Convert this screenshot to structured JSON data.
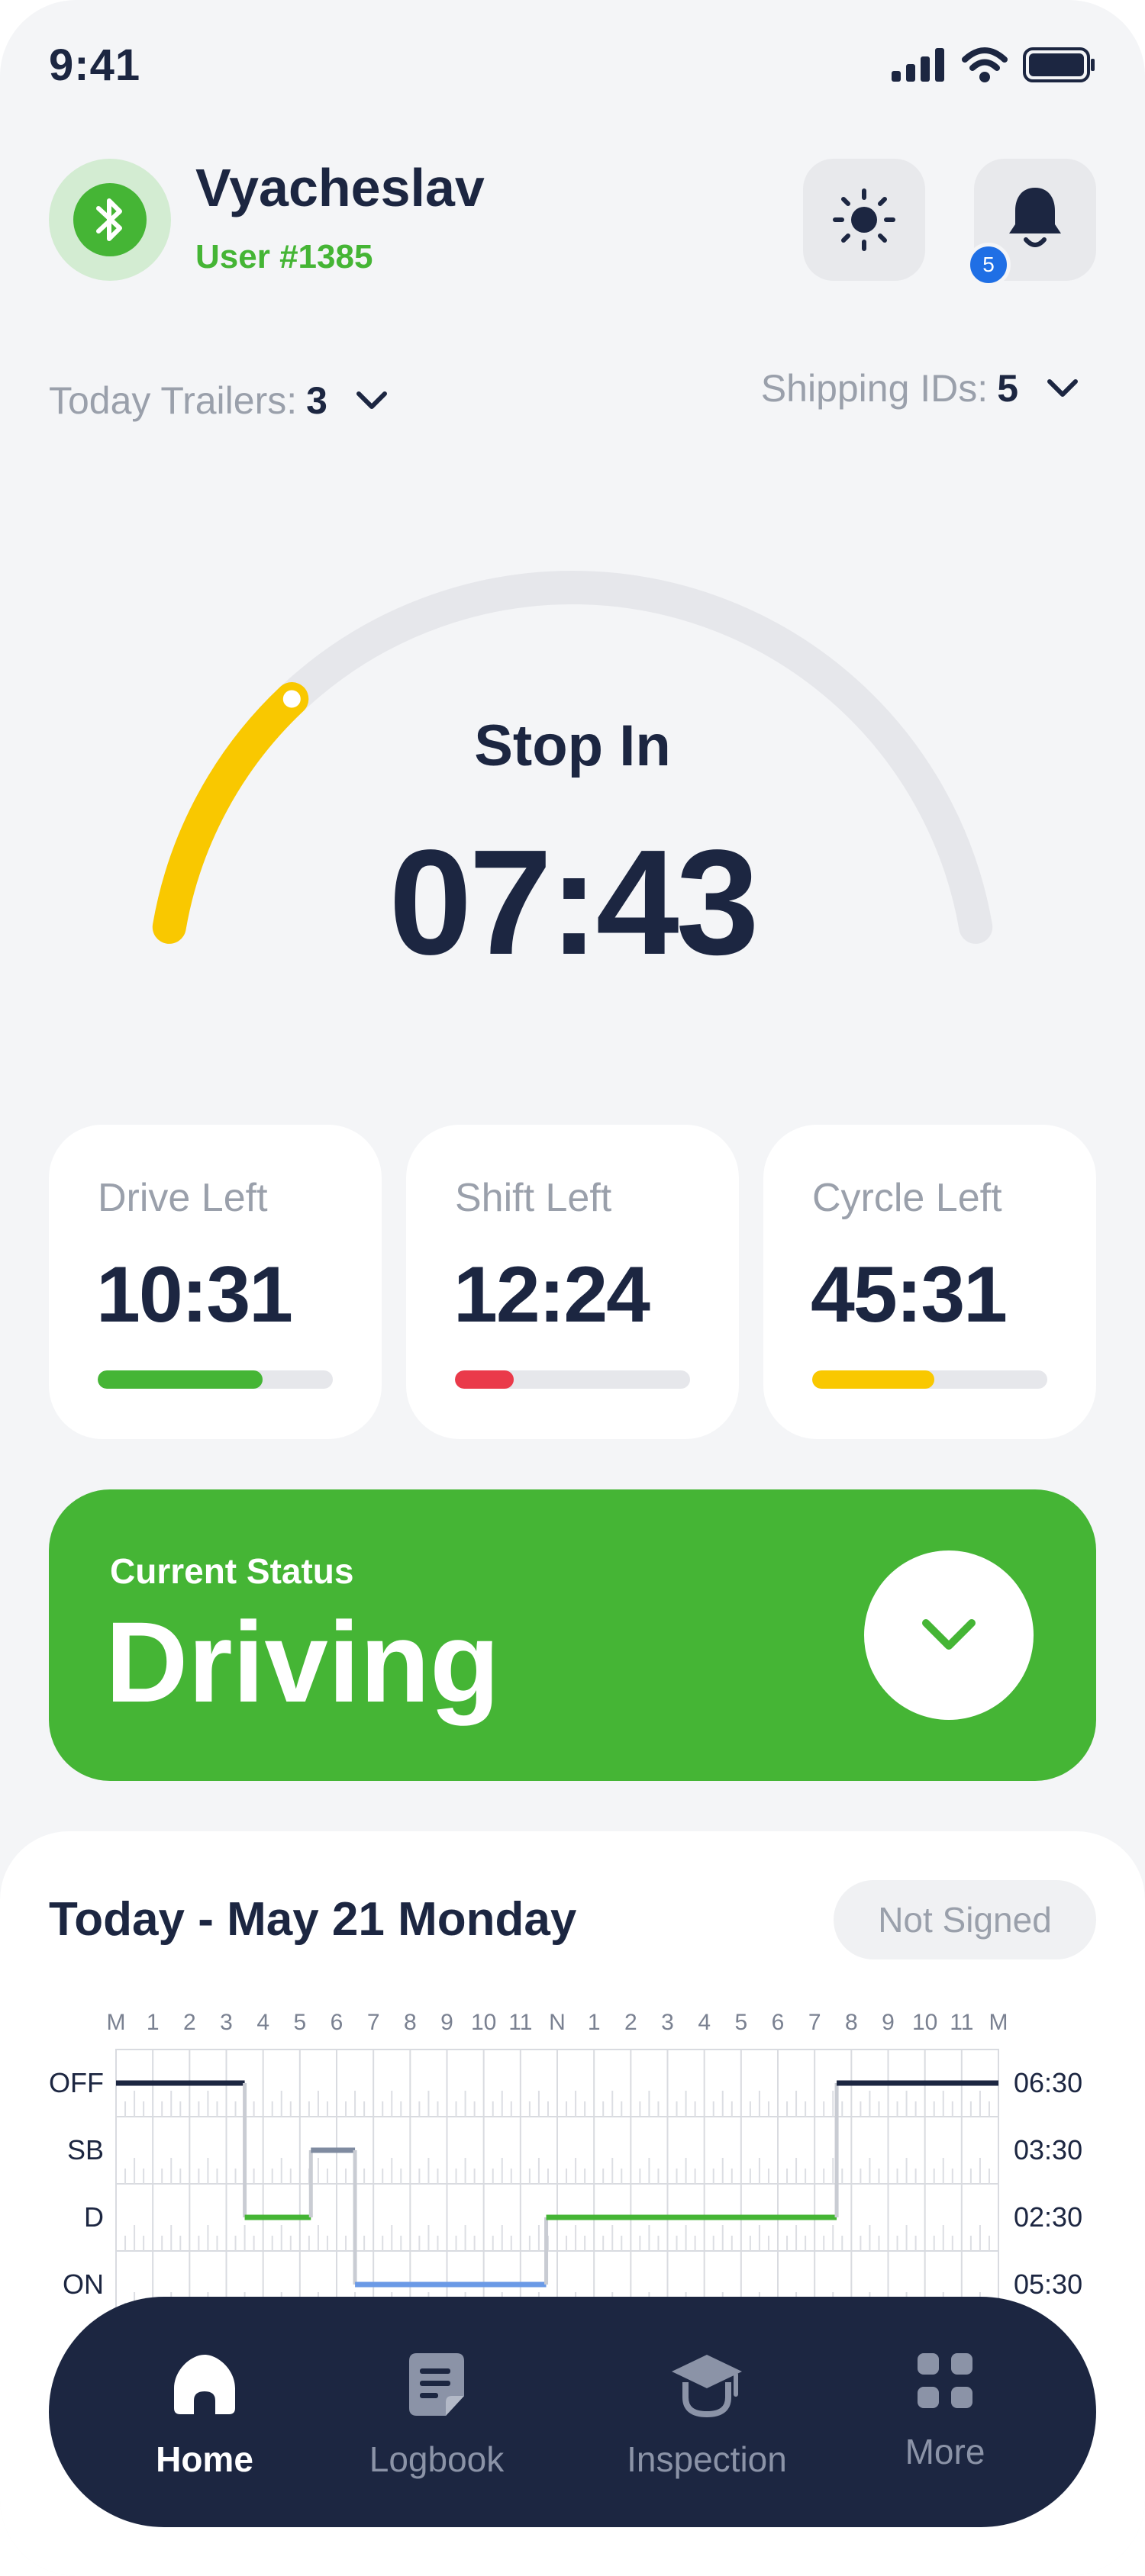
{
  "status_bar": {
    "time": "9:41"
  },
  "header": {
    "user_name": "Vyacheslav",
    "user_id": "User #1385",
    "notification_count": "5"
  },
  "selectors": {
    "trailers_label": "Today Trailers:",
    "trailers_value": "3",
    "shipping_label": "Shipping IDs:",
    "shipping_value": "5"
  },
  "gauge": {
    "label": "Stop In",
    "value": "07:43",
    "progress": 0.23,
    "color": "#f9c800",
    "track_color": "#e6e7eb"
  },
  "stats": [
    {
      "label": "Drive Left",
      "value": "10:31",
      "progress": 0.7,
      "color": "#45b535"
    },
    {
      "label": "Shift Left",
      "value": "12:24",
      "progress": 0.25,
      "color": "#ea3a4a"
    },
    {
      "label": "Cyrcle Left",
      "value": "45:31",
      "progress": 0.52,
      "color": "#f9c800"
    }
  ],
  "status_card": {
    "caption": "Current Status",
    "status": "Driving",
    "color": "#45b535"
  },
  "log": {
    "date": "Today - May 21 Monday",
    "sign_status": "Not Signed",
    "hour_labels": [
      "M",
      "1",
      "2",
      "3",
      "4",
      "5",
      "6",
      "7",
      "8",
      "9",
      "10",
      "11",
      "N",
      "1",
      "2",
      "3",
      "4",
      "5",
      "6",
      "7",
      "8",
      "9",
      "10",
      "11",
      "M"
    ],
    "rows": [
      {
        "label": "OFF",
        "total": "06:30",
        "color": "#1c2641"
      },
      {
        "label": "SB",
        "total": "03:30",
        "color": "#7f8ba0"
      },
      {
        "label": "D",
        "total": "02:30",
        "color": "#45b535"
      },
      {
        "label": "ON",
        "total": "05:30",
        "color": "#6b9ae6"
      }
    ],
    "segments": [
      {
        "status": "OFF",
        "start": 0,
        "end": 3.5
      },
      {
        "status": "D",
        "start": 3.5,
        "end": 5.3
      },
      {
        "status": "SB",
        "start": 5.3,
        "end": 6.5
      },
      {
        "status": "ON",
        "start": 6.5,
        "end": 11.7
      },
      {
        "status": "D",
        "start": 11.7,
        "end": 19.6
      },
      {
        "status": "OFF",
        "start": 19.6,
        "end": 24
      }
    ]
  },
  "nav": {
    "items": [
      {
        "label": "Home",
        "icon": "home-icon"
      },
      {
        "label": "Logbook",
        "icon": "logbook-icon"
      },
      {
        "label": "Inspection",
        "icon": "inspection-icon"
      },
      {
        "label": "More",
        "icon": "grid-icon"
      }
    ],
    "active_index": 0
  }
}
